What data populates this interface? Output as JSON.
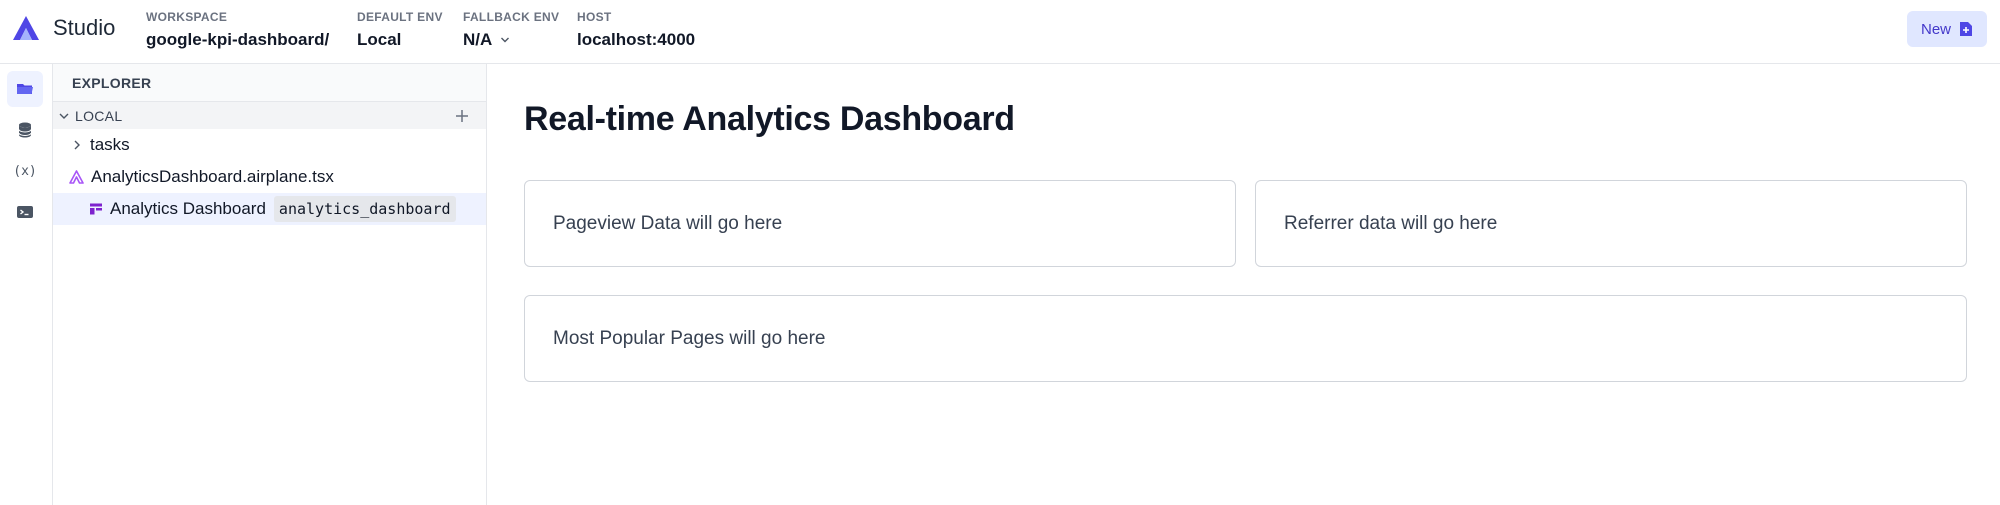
{
  "header": {
    "app_title": "Studio",
    "workspace_label": "WORKSPACE",
    "workspace_value": "google-kpi-dashboard/",
    "default_env_label": "DEFAULT ENV",
    "default_env_value": "Local",
    "fallback_env_label": "FALLBACK ENV",
    "fallback_env_value": "N/A",
    "host_label": "HOST",
    "host_value": "localhost:4000",
    "new_button": "New"
  },
  "rail": {
    "items": [
      "folder-icon",
      "database-icon",
      "variables-icon",
      "terminal-icon"
    ],
    "variables_text": "(x)"
  },
  "explorer": {
    "title": "EXPLORER",
    "section": "LOCAL",
    "items": [
      {
        "label": "tasks",
        "icon": "chevron-right-icon"
      },
      {
        "label": "AnalyticsDashboard.airplane.tsx",
        "icon": "airplane-logo-icon"
      },
      {
        "label": "Analytics Dashboard",
        "slug": "analytics_dashboard",
        "icon": "view-icon",
        "selected": true
      }
    ]
  },
  "main": {
    "title": "Real-time Analytics Dashboard",
    "cards": [
      "Pageview Data will go here",
      "Referrer data will go here",
      "Most Popular Pages will go here"
    ]
  },
  "colors": {
    "accent": "#4f46e5",
    "accent_light": "#e0e7ff",
    "selected_bg": "#eef2ff",
    "logo_purple": "#a855f7"
  }
}
